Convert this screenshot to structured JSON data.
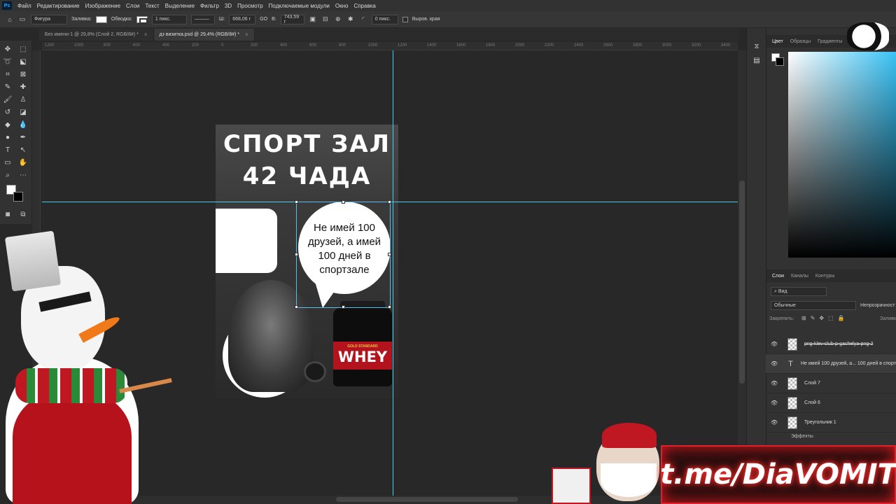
{
  "menu": {
    "logo": "Ps",
    "items": [
      "Файл",
      "Редактирование",
      "Изображение",
      "Слои",
      "Текст",
      "Выделение",
      "Фильтр",
      "3D",
      "Просмотр",
      "Подключаемые модули",
      "Окно",
      "Справка"
    ]
  },
  "options": {
    "shape_mode": "Фигура",
    "fill_label": "Заливка:",
    "stroke_label": "Обводка:",
    "stroke_width": "1 пикс.",
    "width_label": "Ш:",
    "width_value": "668,06 г",
    "link_label": "GO",
    "height_label": "В:",
    "height_value": "743,59 г",
    "radius_value": "0 пикс.",
    "align_edges": "Выров. края"
  },
  "tabs": [
    {
      "label": "Без имени-1 @ 29,8% (Слой 2, RGB/8#) *",
      "active": false
    },
    {
      "label": "дз визитка.psd @ 29,4% (RGB/8#) *",
      "active": true
    }
  ],
  "ruler": {
    "ticks": [
      "1200",
      "1000",
      "800",
      "600",
      "400",
      "200",
      "0",
      "200",
      "400",
      "600",
      "800",
      "1000",
      "1200",
      "1400",
      "1600",
      "1800",
      "2000",
      "2200",
      "2400",
      "2600",
      "2800",
      "3000",
      "3200",
      "3400"
    ]
  },
  "document": {
    "title_line1": "СПОРТ ЗАЛ",
    "title_line2": "42 ЧАДА",
    "bubble_text": "Не имей 100 друзей, а имей 100 дней в спортзале",
    "whey_small": "GOLD STANDARD",
    "whey_big": "WHEY"
  },
  "panel": {
    "color_tabs": [
      "Цвет",
      "Образцы",
      "Градиенты"
    ],
    "layer_tabs": [
      "Слои",
      "Каналы",
      "Контуры"
    ],
    "filter_label": "Вид",
    "blend_mode": "Обычные",
    "opacity_label": "Непрозрачност",
    "lock_label": "Закрепить:",
    "fill_label": "Заливк",
    "layers": [
      {
        "name": "png-klev-club-p-gachelya-png-2",
        "type": "image"
      },
      {
        "name": "Не имей 100 друзей, а... 100 дней в спорт",
        "type": "text"
      },
      {
        "name": "Слой 7",
        "type": "image"
      },
      {
        "name": "Слой 6",
        "type": "image"
      },
      {
        "name": "Треугольник 1",
        "type": "shape"
      }
    ],
    "effects_label": "Эффекты"
  },
  "overlay": {
    "telegram": "t.me/DiaVOMIT"
  },
  "colors": {
    "guide": "#3fd0e8",
    "selection": "#5bbcf0",
    "banner_glow": "#e0202a"
  }
}
